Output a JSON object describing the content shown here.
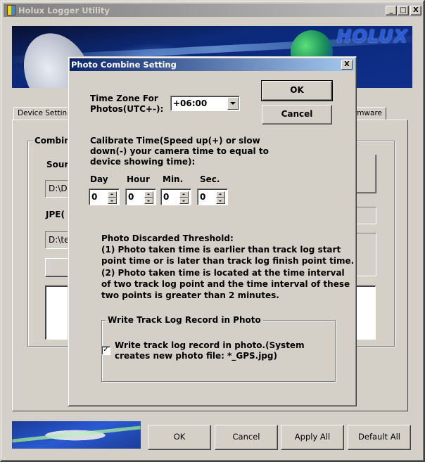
{
  "main_window": {
    "title": "Holux Logger Utility",
    "controls": {
      "minimize": "_",
      "maximize": "□",
      "close": "X"
    },
    "banner_logo": "HOLUX",
    "tabs": [
      {
        "label": "Device Setting",
        "active": false
      },
      {
        "label": "Firmware",
        "active": false
      }
    ],
    "combine_group_label": "Combin",
    "source_label": "Sour",
    "source_field": "D:\\D",
    "jpeg_label": "JPE(",
    "jpeg_field": "D:\\te",
    "bottom_buttons": {
      "ok": "OK",
      "cancel": "Cancel",
      "apply_all": "Apply All",
      "default_all": "Default All"
    }
  },
  "dialog": {
    "title": "Photo Combine Setting",
    "close": "X",
    "timezone_label_1": "Time Zone For",
    "timezone_label_2": "Photos(UTC+-):",
    "timezone_value": "+06:00",
    "ok_label": "OK",
    "cancel_label": "Cancel",
    "calibrate_lines": [
      "Calibrate Time(Speed up(+) or slow",
      "down(-) your camera time to equal to",
      "device showing time):"
    ],
    "spinners": [
      {
        "label": "Day",
        "value": "0"
      },
      {
        "label": "Hour",
        "value": "0"
      },
      {
        "label": "Min.",
        "value": "0"
      },
      {
        "label": "Sec.",
        "value": "0"
      }
    ],
    "threshold_lines": [
      "Photo Discarded Threshold:",
      "(1) Photo taken time is earlier than track log start",
      "point time or is later than track log finish point time.",
      "(2) Photo taken time is located at the time interval",
      "of two track log point and the time interval of these",
      "two points is greater than 2 minutes."
    ],
    "write_group_label": "Write Track Log Record in Photo",
    "write_checkbox_checked": true,
    "write_checkbox_mark": "✓",
    "write_checkbox_lines": [
      "Write track log record in photo.(System",
      "creates new photo file: *_GPS.jpg)"
    ]
  }
}
